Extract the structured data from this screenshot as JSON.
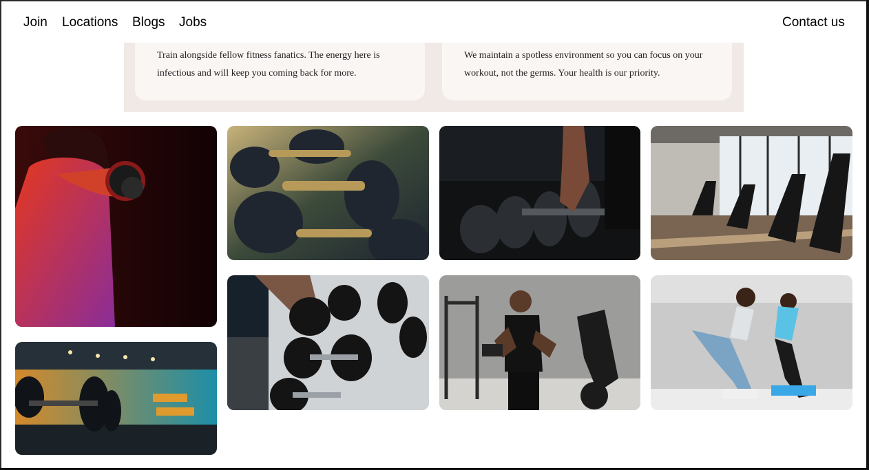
{
  "nav": {
    "links": [
      "Join",
      "Locations",
      "Blogs",
      "Jobs"
    ],
    "contact": "Contact us"
  },
  "features": [
    {
      "text": "Train alongside fellow fitness fanatics. The energy here is infectious and will keep you coming back for more."
    },
    {
      "text": "We maintain a spotless environment so you can focus on your workout, not the germs. Your health is our priority."
    }
  ],
  "gallery": [
    {
      "name": "woman-lifting-dumbbell-photo"
    },
    {
      "name": "dumbbell-rack-closeup-photo"
    },
    {
      "name": "hand-grabbing-dumbbell-photo"
    },
    {
      "name": "spin-bikes-room-photo"
    },
    {
      "name": "gym-dumbbell-row-blue-photo"
    },
    {
      "name": "man-lifting-dumbbells-rack-photo"
    },
    {
      "name": "man-curling-dumbbell-photo"
    },
    {
      "name": "couple-stretching-photo"
    }
  ]
}
